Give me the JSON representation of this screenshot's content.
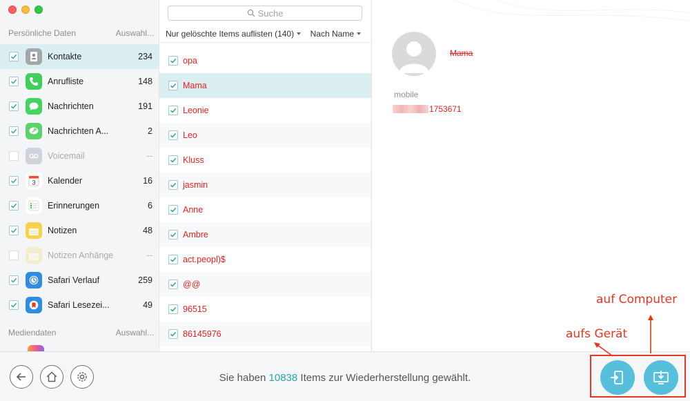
{
  "search": {
    "placeholder": "Suche"
  },
  "sidebar": {
    "personal_header": "Persönliche Daten",
    "personal_select": "Auswahl...",
    "media_header": "Mediendaten",
    "media_select": "Auswahl...",
    "items": [
      {
        "label": "Kontakte",
        "count": "234",
        "checked": true,
        "selected": true,
        "icon": "contacts-icon",
        "color": "#a5a8ab"
      },
      {
        "label": "Anrufliste",
        "count": "148",
        "checked": true,
        "icon": "phone-icon",
        "color": "#3fcf5a"
      },
      {
        "label": "Nachrichten",
        "count": "191",
        "checked": true,
        "icon": "messages-icon",
        "color": "#45d45e"
      },
      {
        "label": "Nachrichten A...",
        "count": "2",
        "checked": true,
        "icon": "message-attachments-icon",
        "color": "#5bd36d"
      },
      {
        "label": "Voicemail",
        "count": "--",
        "checked": false,
        "disabled": true,
        "icon": "voicemail-icon",
        "color": "#b3b8c6"
      },
      {
        "label": "Kalender",
        "count": "16",
        "checked": true,
        "icon": "calendar-icon",
        "color": "#ffffff"
      },
      {
        "label": "Erinnerungen",
        "count": "6",
        "checked": true,
        "icon": "reminders-icon",
        "color": "#ffffff"
      },
      {
        "label": "Notizen",
        "count": "48",
        "checked": true,
        "icon": "notes-icon",
        "color": "#f7d24a"
      },
      {
        "label": "Notizen Anhänge",
        "count": "--",
        "checked": false,
        "disabled": true,
        "icon": "notes-attachments-icon",
        "color": "#f5e6a8"
      },
      {
        "label": "Safari Verlauf",
        "count": "259",
        "checked": true,
        "icon": "safari-history-icon",
        "color": "#2f8ce0"
      },
      {
        "label": "Safari Lesezei...",
        "count": "49",
        "checked": true,
        "icon": "safari-bookmarks-icon",
        "color": "#2f8ce0"
      }
    ]
  },
  "filter": {
    "label": "Nur gelöschte Items auflisten (140)",
    "sort": "Nach Name"
  },
  "contacts": [
    {
      "name": "opa"
    },
    {
      "name": "Mama",
      "selected": true
    },
    {
      "name": "Leonie"
    },
    {
      "name": "Leo"
    },
    {
      "name": "Kluss"
    },
    {
      "name": "jasmin"
    },
    {
      "name": "Anne"
    },
    {
      "name": "Ambre"
    },
    {
      "name": "act.peopl)$"
    },
    {
      "name": "@@"
    },
    {
      "name": "96515"
    },
    {
      "name": "86145976"
    }
  ],
  "detail": {
    "name": "Mama",
    "field_label": "mobile",
    "phone_suffix": "1753671"
  },
  "status": {
    "prefix": "Sie haben",
    "count": "10838",
    "suffix": "Items zur Wiederherstellung gewählt."
  },
  "annotations": {
    "computer": "auf Computer",
    "device": "aufs Gerät"
  },
  "colors": {
    "deleted_red": "#e8211e",
    "accent_teal": "#2aa6a8",
    "action_blue": "#55bfdc",
    "highlight_red": "#e8351e",
    "selected_row": "#dbeff2"
  }
}
